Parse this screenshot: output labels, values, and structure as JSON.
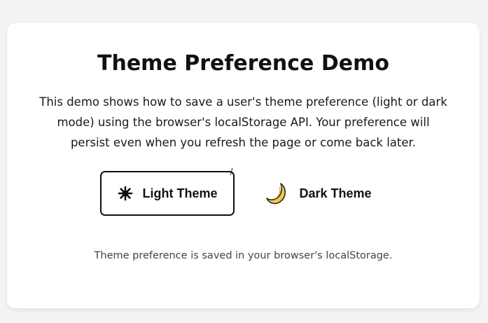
{
  "page": {
    "title": "Theme Preference Demo",
    "description": "This demo shows how to save a user's theme preference (light or dark mode) using the browser's localStorage API. Your preference will persist even when you refresh the page or come back later.",
    "footer": "Theme preference is saved in your browser's localStorage."
  },
  "buttons": {
    "light": {
      "label": "Light Theme",
      "icon": "sun-icon",
      "selected": true
    },
    "dark": {
      "label": "Dark Theme",
      "icon": "moon-icon",
      "selected": false
    }
  },
  "colors": {
    "background": "#f3f3f3",
    "card": "#ffffff",
    "text": "#111111",
    "moon": "#f4c74a"
  }
}
